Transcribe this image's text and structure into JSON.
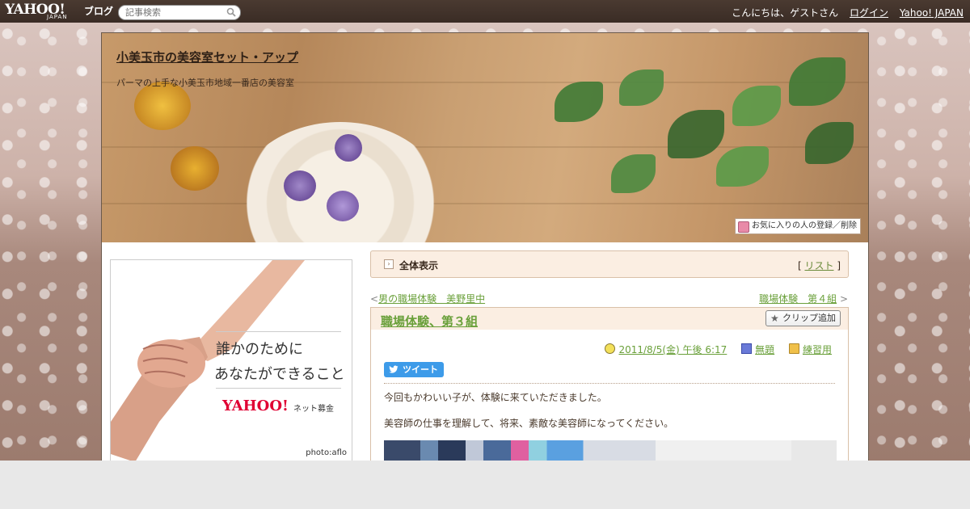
{
  "topbar": {
    "logo_yahoo": "YAHOO!",
    "logo_japan": "JAPAN",
    "logo_blog": "ブログ",
    "search_placeholder": "記事検索",
    "greeting": "こんにちは、ゲストさん",
    "login": "ログイン",
    "yahoo_japan": "Yahoo! JAPAN"
  },
  "blog": {
    "title": "小美玉市の美容室セット・アップ",
    "subtitle": "パーマの上手な小美玉市地域一番店の美容室",
    "fav_button": "お気に入りの人の登録／削除"
  },
  "ad": {
    "line1": "誰かのために",
    "line2": "あなたができること",
    "brand": "YAHOO!",
    "brand_sub": "ネット募金",
    "credit": "photo:aflo"
  },
  "view_all": {
    "label": "全体表示",
    "list_open": "[",
    "list_link": "リスト",
    "list_close": "]"
  },
  "nav": {
    "prev_arrow": "<",
    "prev_title": "男の職場体験　美野里中",
    "next_title": "職場体験　第４組",
    "next_arrow": ">"
  },
  "article": {
    "title": "職場体験、第３組",
    "clip_button": "クリップ追加",
    "date": "2011/8/5(金) 午後 6:17",
    "theme": "無題",
    "category": "練習用",
    "tweet": "ツイート",
    "paragraph1": "今回もかわいい子が、体験に来ていただきました。",
    "paragraph2": "美容師の仕事を理解して、将来、素敵な美容師になってください。"
  }
}
